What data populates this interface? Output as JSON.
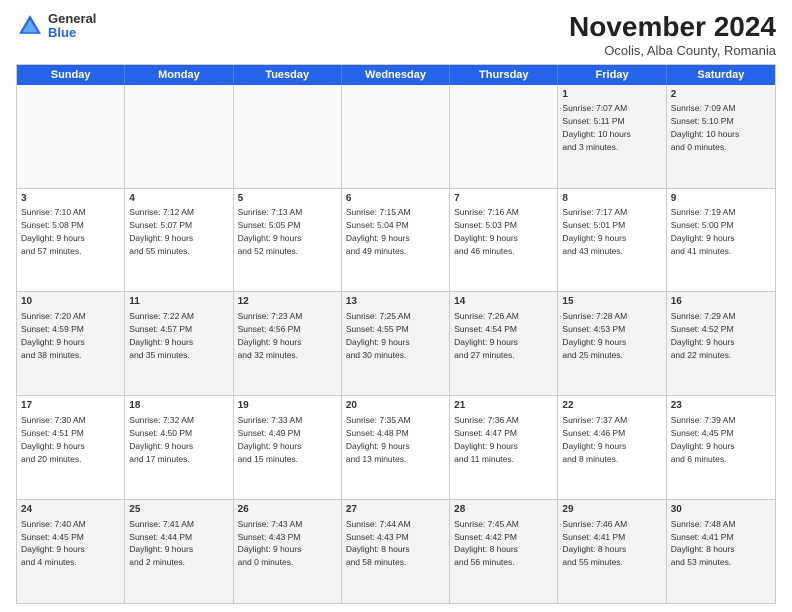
{
  "logo": {
    "general": "General",
    "blue": "Blue"
  },
  "title": "November 2024",
  "location": "Ocolis, Alba County, Romania",
  "header_days": [
    "Sunday",
    "Monday",
    "Tuesday",
    "Wednesday",
    "Thursday",
    "Friday",
    "Saturday"
  ],
  "rows": [
    [
      {
        "day": "",
        "info": ""
      },
      {
        "day": "",
        "info": ""
      },
      {
        "day": "",
        "info": ""
      },
      {
        "day": "",
        "info": ""
      },
      {
        "day": "",
        "info": ""
      },
      {
        "day": "1",
        "info": "Sunrise: 7:07 AM\nSunset: 5:11 PM\nDaylight: 10 hours\nand 3 minutes."
      },
      {
        "day": "2",
        "info": "Sunrise: 7:09 AM\nSunset: 5:10 PM\nDaylight: 10 hours\nand 0 minutes."
      }
    ],
    [
      {
        "day": "3",
        "info": "Sunrise: 7:10 AM\nSunset: 5:08 PM\nDaylight: 9 hours\nand 57 minutes."
      },
      {
        "day": "4",
        "info": "Sunrise: 7:12 AM\nSunset: 5:07 PM\nDaylight: 9 hours\nand 55 minutes."
      },
      {
        "day": "5",
        "info": "Sunrise: 7:13 AM\nSunset: 5:05 PM\nDaylight: 9 hours\nand 52 minutes."
      },
      {
        "day": "6",
        "info": "Sunrise: 7:15 AM\nSunset: 5:04 PM\nDaylight: 9 hours\nand 49 minutes."
      },
      {
        "day": "7",
        "info": "Sunrise: 7:16 AM\nSunset: 5:03 PM\nDaylight: 9 hours\nand 46 minutes."
      },
      {
        "day": "8",
        "info": "Sunrise: 7:17 AM\nSunset: 5:01 PM\nDaylight: 9 hours\nand 43 minutes."
      },
      {
        "day": "9",
        "info": "Sunrise: 7:19 AM\nSunset: 5:00 PM\nDaylight: 9 hours\nand 41 minutes."
      }
    ],
    [
      {
        "day": "10",
        "info": "Sunrise: 7:20 AM\nSunset: 4:59 PM\nDaylight: 9 hours\nand 38 minutes."
      },
      {
        "day": "11",
        "info": "Sunrise: 7:22 AM\nSunset: 4:57 PM\nDaylight: 9 hours\nand 35 minutes."
      },
      {
        "day": "12",
        "info": "Sunrise: 7:23 AM\nSunset: 4:56 PM\nDaylight: 9 hours\nand 32 minutes."
      },
      {
        "day": "13",
        "info": "Sunrise: 7:25 AM\nSunset: 4:55 PM\nDaylight: 9 hours\nand 30 minutes."
      },
      {
        "day": "14",
        "info": "Sunrise: 7:26 AM\nSunset: 4:54 PM\nDaylight: 9 hours\nand 27 minutes."
      },
      {
        "day": "15",
        "info": "Sunrise: 7:28 AM\nSunset: 4:53 PM\nDaylight: 9 hours\nand 25 minutes."
      },
      {
        "day": "16",
        "info": "Sunrise: 7:29 AM\nSunset: 4:52 PM\nDaylight: 9 hours\nand 22 minutes."
      }
    ],
    [
      {
        "day": "17",
        "info": "Sunrise: 7:30 AM\nSunset: 4:51 PM\nDaylight: 9 hours\nand 20 minutes."
      },
      {
        "day": "18",
        "info": "Sunrise: 7:32 AM\nSunset: 4:50 PM\nDaylight: 9 hours\nand 17 minutes."
      },
      {
        "day": "19",
        "info": "Sunrise: 7:33 AM\nSunset: 4:49 PM\nDaylight: 9 hours\nand 15 minutes."
      },
      {
        "day": "20",
        "info": "Sunrise: 7:35 AM\nSunset: 4:48 PM\nDaylight: 9 hours\nand 13 minutes."
      },
      {
        "day": "21",
        "info": "Sunrise: 7:36 AM\nSunset: 4:47 PM\nDaylight: 9 hours\nand 11 minutes."
      },
      {
        "day": "22",
        "info": "Sunrise: 7:37 AM\nSunset: 4:46 PM\nDaylight: 9 hours\nand 8 minutes."
      },
      {
        "day": "23",
        "info": "Sunrise: 7:39 AM\nSunset: 4:45 PM\nDaylight: 9 hours\nand 6 minutes."
      }
    ],
    [
      {
        "day": "24",
        "info": "Sunrise: 7:40 AM\nSunset: 4:45 PM\nDaylight: 9 hours\nand 4 minutes."
      },
      {
        "day": "25",
        "info": "Sunrise: 7:41 AM\nSunset: 4:44 PM\nDaylight: 9 hours\nand 2 minutes."
      },
      {
        "day": "26",
        "info": "Sunrise: 7:43 AM\nSunset: 4:43 PM\nDaylight: 9 hours\nand 0 minutes."
      },
      {
        "day": "27",
        "info": "Sunrise: 7:44 AM\nSunset: 4:43 PM\nDaylight: 8 hours\nand 58 minutes."
      },
      {
        "day": "28",
        "info": "Sunrise: 7:45 AM\nSunset: 4:42 PM\nDaylight: 8 hours\nand 56 minutes."
      },
      {
        "day": "29",
        "info": "Sunrise: 7:46 AM\nSunset: 4:41 PM\nDaylight: 8 hours\nand 55 minutes."
      },
      {
        "day": "30",
        "info": "Sunrise: 7:48 AM\nSunset: 4:41 PM\nDaylight: 8 hours\nand 53 minutes."
      }
    ]
  ]
}
